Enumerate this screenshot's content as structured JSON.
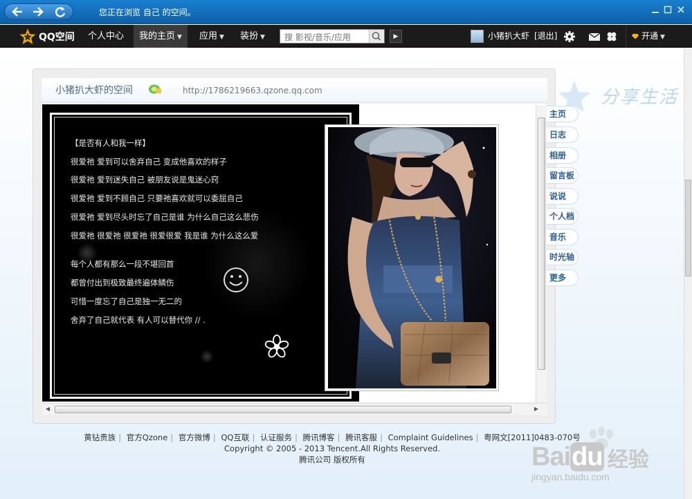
{
  "browser": {
    "status_text": "您正在浏览 自己 的空间。",
    "icons": [
      "back-arrow-icon",
      "forward-arrow-icon",
      "refresh-icon",
      "minimize-icon",
      "maximize-icon",
      "close-icon"
    ]
  },
  "toolbar": {
    "logo_text": "QQ空间",
    "nav": [
      {
        "label": "个人中心",
        "has_dropdown": false
      },
      {
        "label": "我的主页",
        "has_dropdown": true
      },
      {
        "label": "应用",
        "has_dropdown": true
      },
      {
        "label": "装扮",
        "has_dropdown": true
      }
    ],
    "search_placeholder": "搜 影视/音乐/应用",
    "user_name": "小猪扒大虾",
    "logout_label": "[退出]",
    "open_label": "开通",
    "icons": [
      "settings-icon",
      "mail-icon",
      "clover-icon"
    ]
  },
  "space": {
    "title": "小猪扒大虾的空间",
    "url": "http://1786219663.qzone.qq.com"
  },
  "poem": {
    "lines_group1": [
      "【是否有人和我一样】",
      "很爱祂  爱到可以舍弃自己  变成他喜欢的样子",
      "很爱祂  爱到迷失自己  被朋友说是鬼迷心窍",
      "很爱祂  爱到不顾自己  只要祂喜欢就可以委屈自己",
      "很爱祂  爱到尽头时忘了自己是谁  为什么自己这么悲伤",
      "很爱祂  很爱祂  很爱祂  很爱很爱  我是谁  为什么这么爱"
    ],
    "lines_group2": [
      "每个人都有那么一段不堪回首",
      "都曾付出到极致最终遍体鳞伤",
      "可惜一度忘了自己是独一无二的",
      "舍弃了自己就代表  有人可以替代你    //  ."
    ]
  },
  "side_tabs": [
    "主页",
    "日志",
    "相册",
    "留言板",
    "说说",
    "个人档",
    "音乐",
    "时光轴",
    "更多"
  ],
  "footer": {
    "links": [
      "黄钻贵族",
      "官方Qzone",
      "官方微博",
      "QQ互联",
      "认证服务",
      "腾讯博客",
      "腾讯客服",
      "Complaint Guidelines",
      "粤网文[2011]0483-070号"
    ],
    "copyright": "Copyright © 2005 - 2013 Tencent.All Rights Reserved.",
    "company": "腾讯公司 版权所有"
  },
  "watermark": {
    "brand": "Bai",
    "brand_tail": "du",
    "label_cn": "经验",
    "url": "jingyan.baidu.com"
  },
  "decoration": {
    "handwriting": "分享生活"
  }
}
